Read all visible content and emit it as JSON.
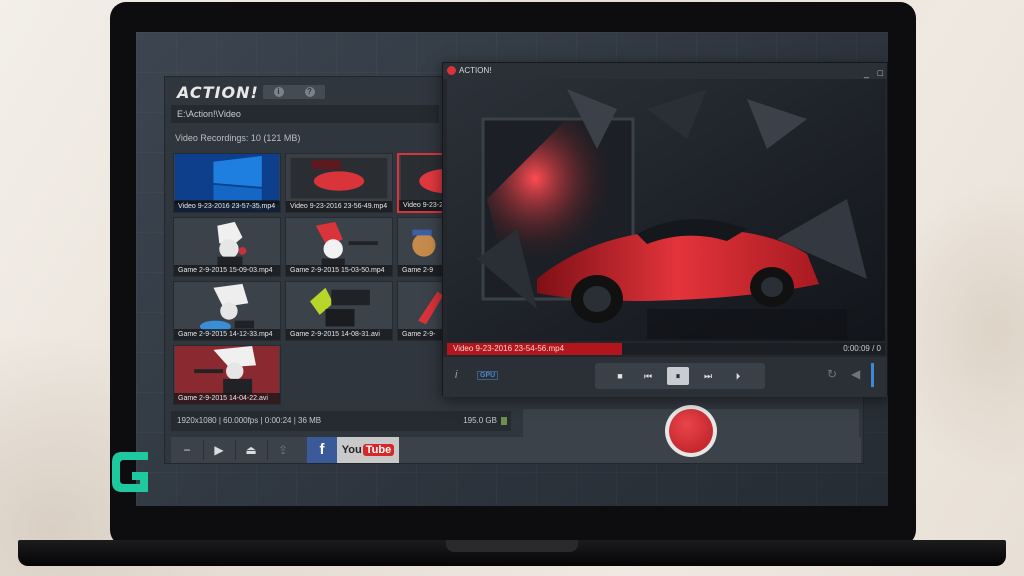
{
  "app": {
    "logo_text": "ACTION!",
    "header_buttons": [
      "i",
      "?"
    ]
  },
  "library": {
    "path": "E:\\Action!\\Video",
    "recordings_label": "Video Recordings: 10 (121 MB)",
    "items": [
      {
        "label": "Video 9-23-2016 23-57-35.mp4",
        "selected": false
      },
      {
        "label": "Video 9-23-2016 23-56-49.mp4",
        "selected": false
      },
      {
        "label": "Video 9-23-2",
        "selected": true
      },
      {
        "label": "Game 2-9-2015 15-09-03.mp4",
        "selected": false
      },
      {
        "label": "Game 2-9-2015 15-03-50.mp4",
        "selected": false
      },
      {
        "label": "Game 2-9",
        "selected": false
      },
      {
        "label": "Game 2-9-2015 14-12-33.mp4",
        "selected": false
      },
      {
        "label": "Game 2-9-2015 14-08-31.avi",
        "selected": false
      },
      {
        "label": "Game 2-9-",
        "selected": false
      },
      {
        "label": "Game 2-9-2015 14-04-22.avi",
        "selected": false
      }
    ],
    "info_line": "1920x1080 | 60.000fps | 0:00:24 | 36 MB",
    "disk_free": "195.0 GB"
  },
  "toolbar": {
    "minus_label": "−",
    "play_label": "▶",
    "folder_label": "⏏",
    "upload_label": "⇪",
    "facebook_label": "f",
    "youtube_you": "You",
    "youtube_tube": "Tube"
  },
  "player": {
    "title": "ACTION!",
    "min": "_",
    "max": "□",
    "file_name": "Video 9-23-2016 23-54-56.mp4",
    "time": "0:00:09 / 0",
    "progress": 0.4,
    "info_icon": "i",
    "gpu_label": "GPU",
    "controls": {
      "stop": "■",
      "prev": "⏮",
      "pause": "⏸",
      "next": "⏭",
      "play": "⏵"
    },
    "repeat_icon": "↻",
    "volume_icon": "◀"
  },
  "colors": {
    "accent_red": "#d8343a",
    "panel": "#30363d",
    "facebook": "#3b5a99"
  }
}
